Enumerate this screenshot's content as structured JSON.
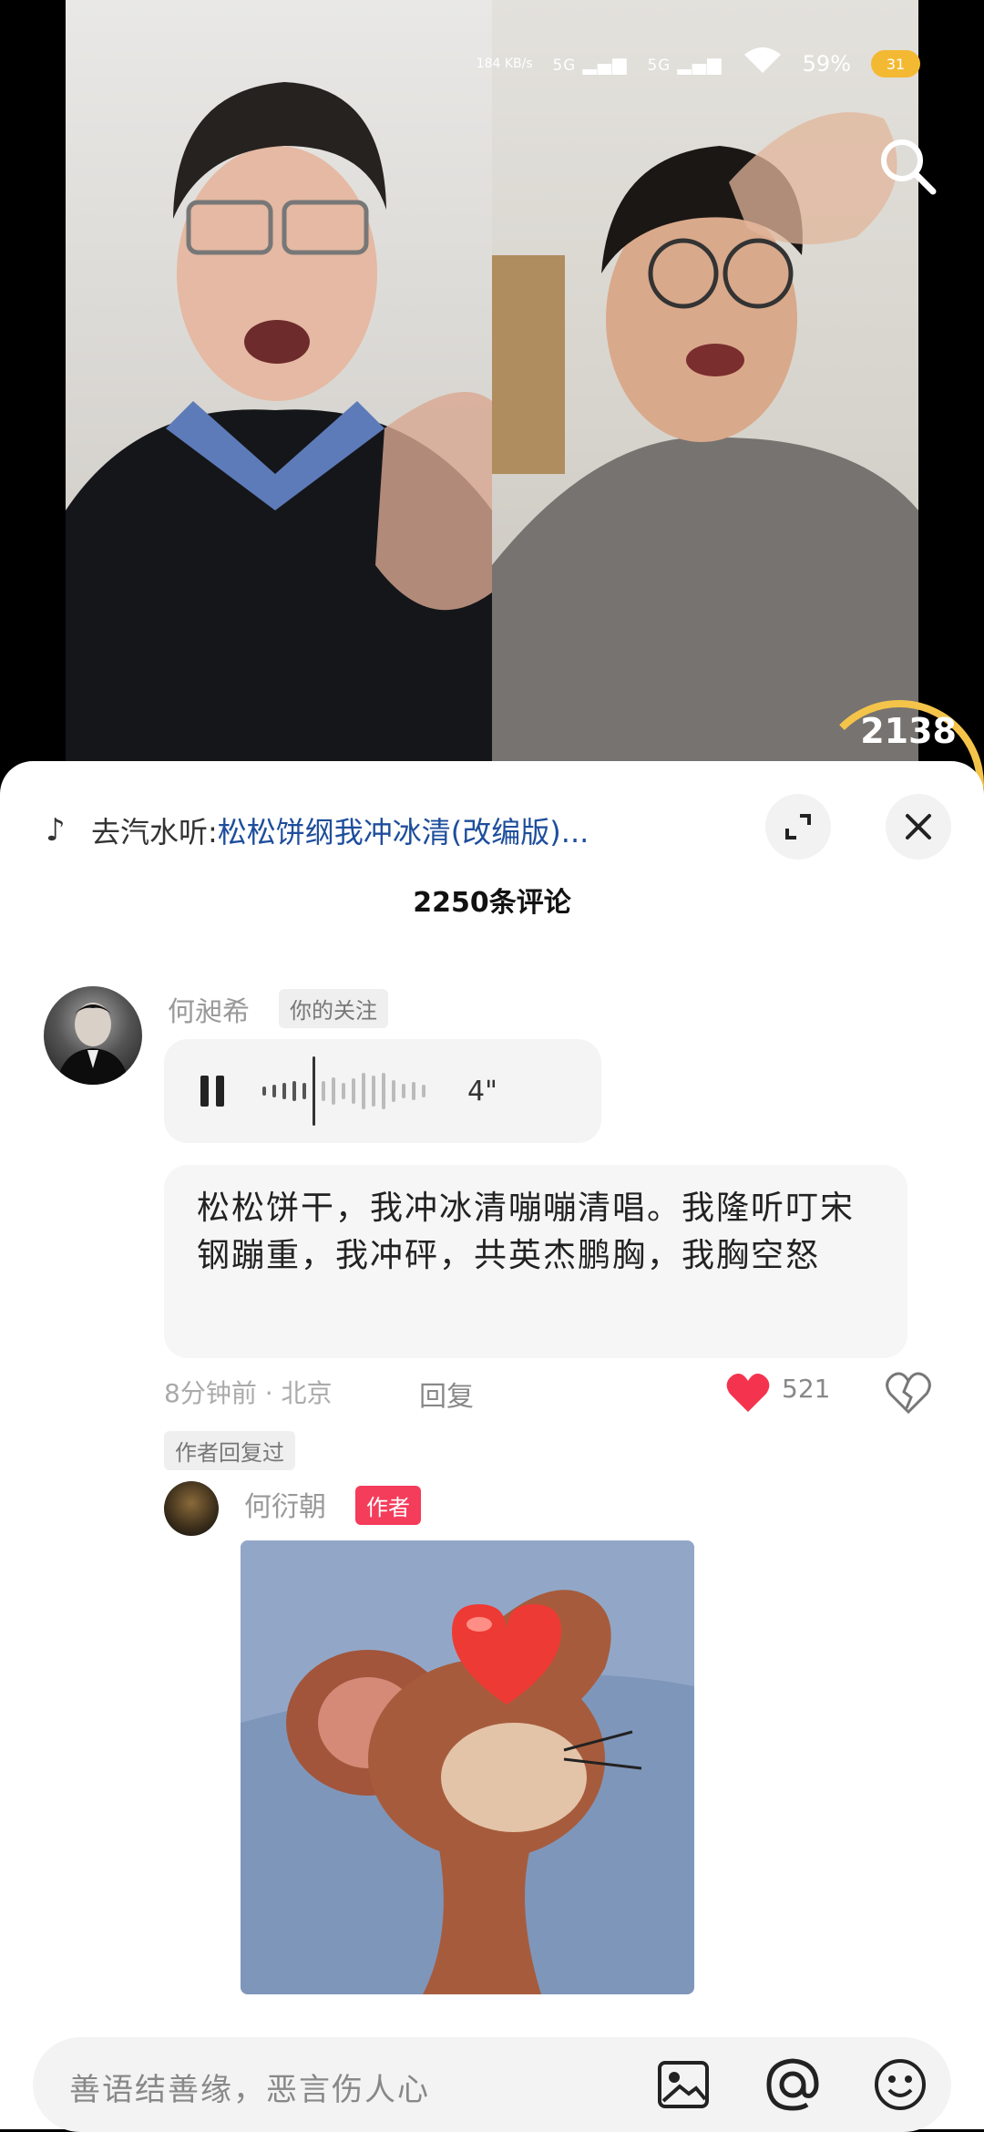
{
  "status_bar": {
    "net_speed": "184 KB/s",
    "sim1": "5G",
    "sim2": "5G",
    "battery": "59%",
    "battery_badge": "31"
  },
  "video": {
    "viewer_count": "2138"
  },
  "sheet": {
    "music_prefix": "去汽水听:",
    "music_title": "松松饼纲我冲冰清(改编版)...",
    "comment_count_title": "2250条评论"
  },
  "comment": {
    "username": "何昶希",
    "follow_tag": "你的关注",
    "voice_duration": "4\"",
    "transcript": "松松饼干，我冲冰清嘣嘣清唱。我隆听叮宋钢蹦重，我冲砰，共英杰鹏胸，我胸空怒",
    "time_location": "8分钟前 · 北京",
    "reply_label": "回复",
    "like_count": "521",
    "author_replied_tag": "作者回复过"
  },
  "reply": {
    "username": "何衍朝",
    "author_badge": "作者"
  },
  "input": {
    "placeholder": "善语结善缘，恶言伤人心"
  },
  "colors": {
    "accent_red": "#f43c5b",
    "link_blue": "#1e4e9c",
    "live_ring": "#f4c44a"
  }
}
